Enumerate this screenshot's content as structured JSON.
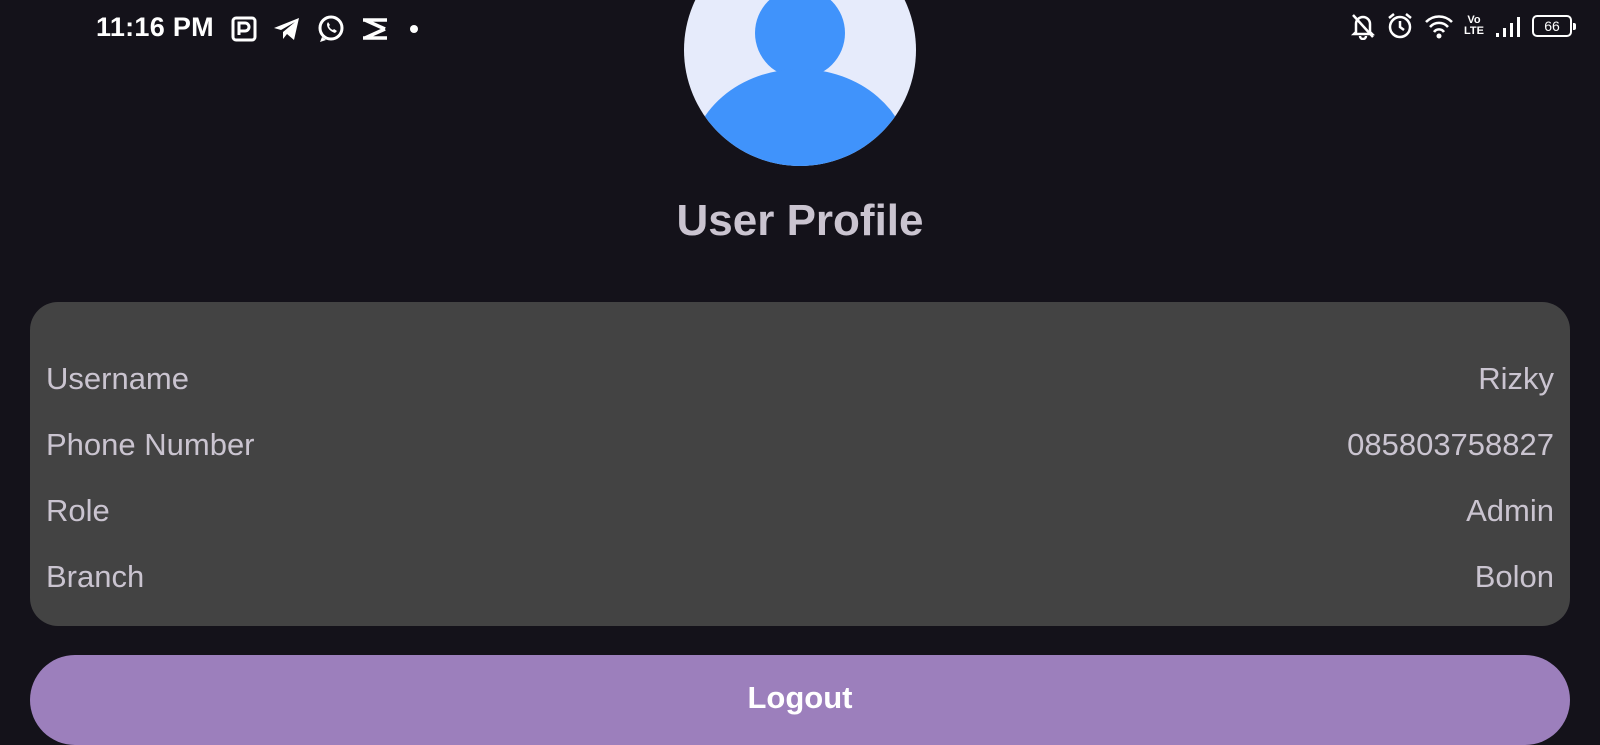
{
  "status_bar": {
    "time": "11:16 PM",
    "left_icons": [
      "parking-app-icon",
      "telegram-icon",
      "whatsapp-icon",
      "capcut-icon",
      "dot-icon"
    ],
    "right_icons": [
      "notifications-off-icon",
      "alarm-icon",
      "wifi-icon",
      "volte-icon",
      "signal-icon"
    ],
    "volte_top": "Vo",
    "volte_bottom": "LTE",
    "battery": "66"
  },
  "header": {
    "title": "User Profile"
  },
  "profile": {
    "rows": [
      {
        "label": "Username",
        "value": "Rizky"
      },
      {
        "label": "Phone Number",
        "value": "085803758827"
      },
      {
        "label": "Role",
        "value": "Admin"
      },
      {
        "label": "Branch",
        "value": "Bolon"
      }
    ]
  },
  "actions": {
    "logout_label": "Logout"
  },
  "colors": {
    "background": "#14121a",
    "card": "#434343",
    "accent": "#9c7fbc",
    "avatar_fg": "#4093fb",
    "avatar_bg": "#e6ebfb"
  }
}
